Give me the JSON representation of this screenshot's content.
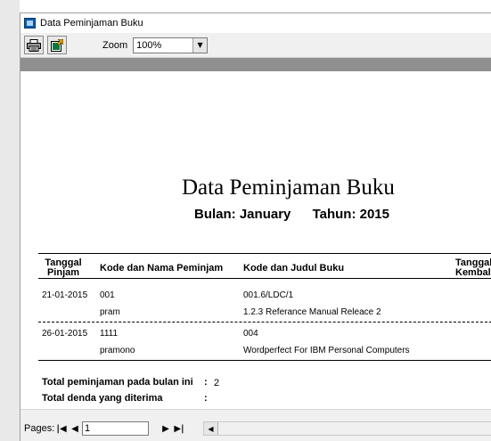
{
  "window": {
    "title": "Data Peminjaman Buku"
  },
  "toolbar": {
    "print_icon": "printer-icon",
    "export_icon": "export-icon",
    "zoom_label": "Zoom",
    "zoom_value": "100%"
  },
  "report": {
    "title": "Data Peminjaman Buku",
    "bulan_label": "Bulan:",
    "bulan_value": "January",
    "tahun_label": "Tahun:",
    "tahun_value": "2015",
    "columns": {
      "tanggal_pinjam_1": "Tanggal",
      "tanggal_pinjam_2": "Pinjam",
      "peminjam": "Kode dan Nama Peminjam",
      "buku": "Kode dan Judul Buku",
      "tanggal_kembali_1": "Tanggal",
      "tanggal_kembali_2": "Kembali"
    },
    "rows": [
      {
        "tanggal": "21-01-2015",
        "kode_peminjam": "001",
        "nama_peminjam": "pram",
        "kode_buku": "001.6/LDC/1",
        "judul_buku": "1.2.3 Referance Manual Releace 2"
      },
      {
        "tanggal": "26-01-2015",
        "kode_peminjam": "1111",
        "nama_peminjam": "pramono",
        "kode_buku": "004",
        "judul_buku": "Wordperfect For IBM Personal Computers"
      }
    ],
    "summary": {
      "total_pinjam_label": "Total peminjaman pada bulan ini",
      "total_pinjam_sep": ":",
      "total_pinjam_value": "2",
      "total_denda_label": "Total denda yang diterima",
      "total_denda_sep": ":",
      "total_denda_value": ""
    }
  },
  "statusbar": {
    "pages_label": "Pages:",
    "page_value": "1"
  }
}
